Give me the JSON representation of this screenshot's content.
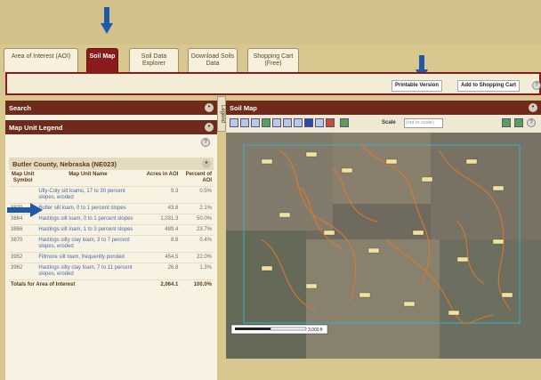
{
  "tabs": [
    {
      "label": "Area of Interest (AOI)",
      "active": false
    },
    {
      "label": "Soil Map",
      "active": true
    },
    {
      "label": "Soil Data Explorer",
      "active": false
    },
    {
      "label": "Download Soils Data",
      "active": false
    },
    {
      "label": "Shopping Cart (Free)",
      "active": false
    }
  ],
  "toolbar": {
    "printable_label": "Printable Version",
    "add_cart_label": "Add to Shopping Cart",
    "help": "?"
  },
  "left": {
    "search_title": "Search",
    "legend_title": "Map Unit Legend",
    "county": "Butler County, Nebraska (NE023)",
    "headers": {
      "symbol": "Map Unit Symbol",
      "name": "Map Unit Name",
      "acres": "Acres in AOI",
      "percent": "Percent of AOI"
    },
    "rows": [
      {
        "symbol": "",
        "name": "Ully-Coly silt loams, 17 to 30 percent slopes, eroded",
        "acres": "9.3",
        "percent": "0.5%"
      },
      {
        "symbol": "3820",
        "name": "Butler silt loam, 0 to 1 percent slopes",
        "acres": "43.8",
        "percent": "2.1%"
      },
      {
        "symbol": "3864",
        "name": "Hastings silt loam, 0 to 1 percent slopes",
        "acres": "1,031.3",
        "percent": "50.0%"
      },
      {
        "symbol": "3866",
        "name": "Hastings silt loam, 1 to 3 percent slopes",
        "acres": "489.4",
        "percent": "23.7%"
      },
      {
        "symbol": "3870",
        "name": "Hastings silty clay loam, 3 to 7 percent slopes, eroded",
        "acres": "8.8",
        "percent": "0.4%"
      },
      {
        "symbol": "3952",
        "name": "Fillmore silt loam, frequently ponded",
        "acres": "454.5",
        "percent": "22.0%"
      },
      {
        "symbol": "3962",
        "name": "Hastings silty clay loam, 7 to 11 percent slopes, eroded",
        "acres": "26.8",
        "percent": "1.3%"
      }
    ],
    "totals_label": "Totals for Area of Interest",
    "totals_acres": "2,064.1",
    "totals_percent": "100.0%"
  },
  "legend_tab": "Legend",
  "map": {
    "title": "Soil Map",
    "scale_label": "Scale",
    "scale_value": "(not to scale)",
    "scalebar_text": "3,000 ft"
  },
  "colors": {
    "accent": "#8b1a1a",
    "panel_bar": "#6e2a1a",
    "arrow": "#1e5aa8",
    "soil_line": "#e07a2a"
  }
}
